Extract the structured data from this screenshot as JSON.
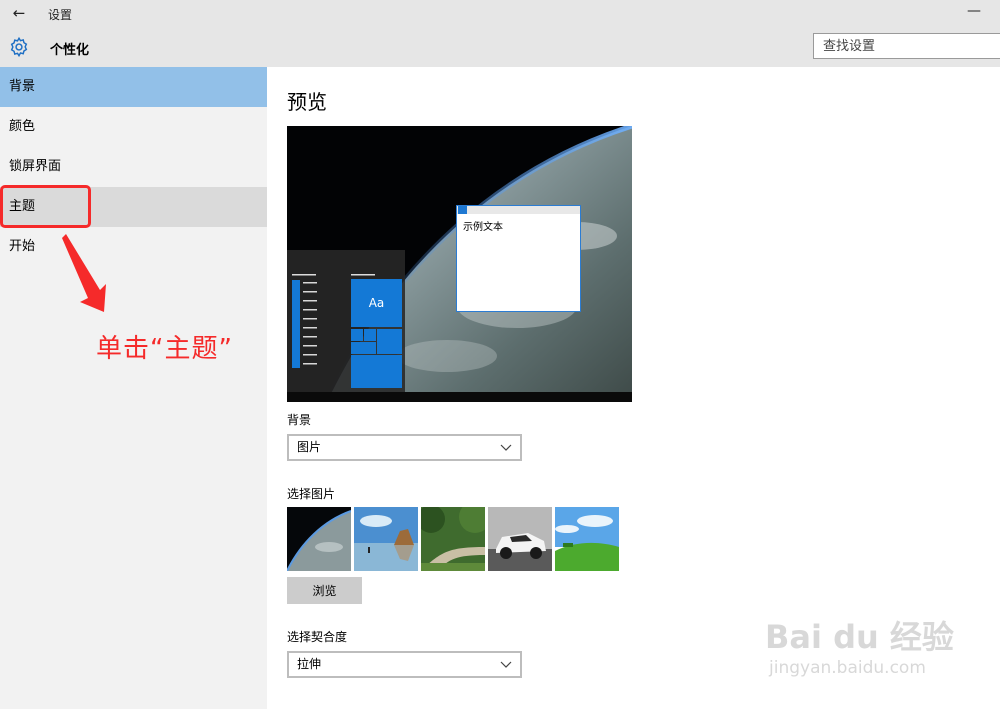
{
  "window": {
    "back_glyph": "←",
    "app_title": "设置",
    "minimize_glyph": "—"
  },
  "header": {
    "icon": "gear-icon",
    "title": "个性化",
    "search_placeholder": "查找设置"
  },
  "sidebar": {
    "items": [
      {
        "label": "背景",
        "state": "selected"
      },
      {
        "label": "颜色",
        "state": "normal"
      },
      {
        "label": "锁屏界面",
        "state": "normal"
      },
      {
        "label": "主题",
        "state": "hover"
      },
      {
        "label": "开始",
        "state": "normal"
      }
    ]
  },
  "annotation": {
    "text": "单击“主题”",
    "color": "#f52a2a"
  },
  "main": {
    "title": "预览",
    "preview": {
      "sample_text": "示例文本",
      "tile_label": "Aa"
    },
    "background": {
      "label": "背景",
      "value": "图片"
    },
    "choose_picture": {
      "label": "选择图片",
      "thumbnails": [
        "earth-from-space",
        "beach-rock-reflection",
        "forest-road",
        "white-sports-car",
        "green-field-sky"
      ]
    },
    "browse_label": "浏览",
    "fit": {
      "label": "选择契合度",
      "value": "拉伸"
    }
  },
  "watermark": {
    "brand": "Bai du 经验",
    "url": "jingyan.baidu.com"
  },
  "colors": {
    "accent": "#1479d6",
    "selected_nav": "#92c0e8",
    "titlebar": "#e6e6e6",
    "sidebar": "#f2f2f2"
  }
}
